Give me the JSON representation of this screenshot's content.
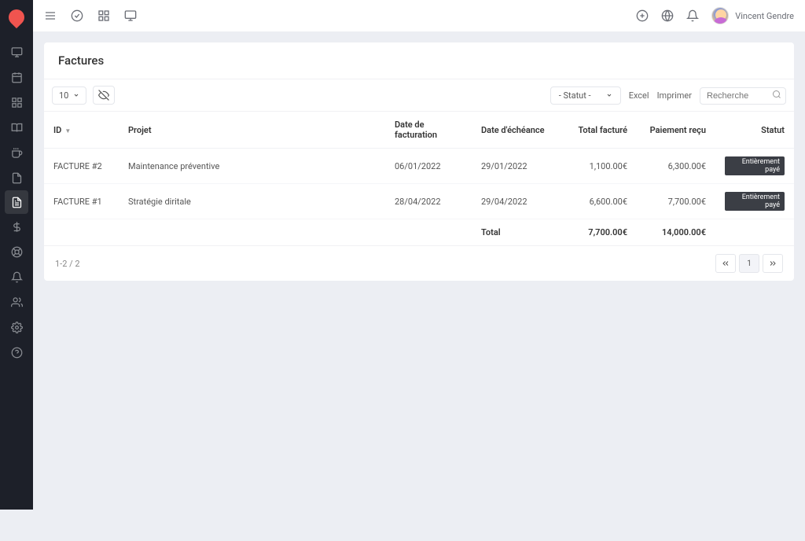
{
  "user": {
    "name": "Vincent Gendre"
  },
  "page": {
    "title": "Factures"
  },
  "toolbar": {
    "page_size": "10",
    "statut_label": "- Statut -",
    "excel_label": "Excel",
    "imprimer_label": "Imprimer",
    "search_placeholder": "Recherche"
  },
  "table": {
    "headers": {
      "id": "ID",
      "projet": "Projet",
      "date_fact": "Date de facturation",
      "date_eche": "Date d'échéance",
      "total_fact": "Total facturé",
      "paiement": "Paiement reçu",
      "statut": "Statut"
    },
    "rows": [
      {
        "id": "FACTURE #2",
        "projet": "Maintenance préventive",
        "date_fact": "06/01/2022",
        "date_eche": "29/01/2022",
        "total": "1,100.00€",
        "paiement": "6,300.00€",
        "statut": "Entièrement payé"
      },
      {
        "id": "FACTURE #1",
        "projet": "Stratégie diritale",
        "date_fact": "28/04/2022",
        "date_eche": "29/04/2022",
        "total": "6,600.00€",
        "paiement": "7,700.00€",
        "statut": "Entièrement payé"
      }
    ],
    "footer": {
      "label": "Total",
      "total": "7,700.00€",
      "paiement": "14,000.00€"
    }
  },
  "footer": {
    "range": "1-2 / 2",
    "page": "1"
  }
}
